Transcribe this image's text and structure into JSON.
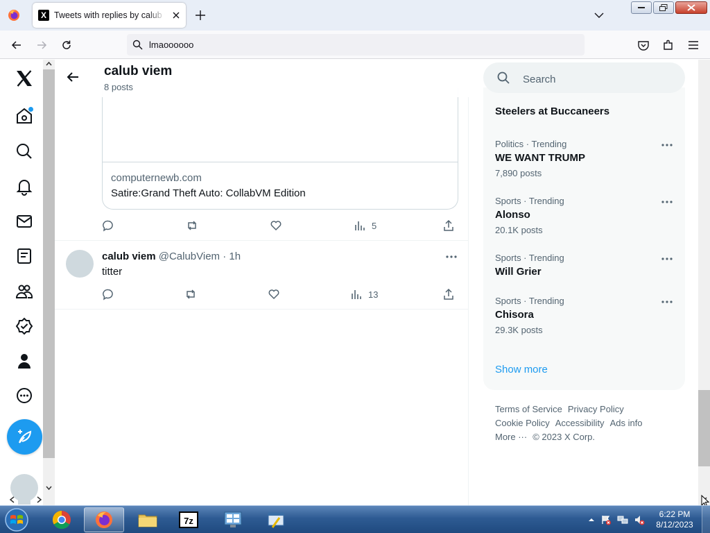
{
  "browser": {
    "tab_title": "Tweets with replies by calub viem",
    "tab_favicon": "X",
    "url": "lmaoooooo"
  },
  "page": {
    "header": {
      "name": "calub viem",
      "post_count": "8 posts"
    },
    "card": {
      "domain": "computernewb.com",
      "title": "Satire:Grand Theft Auto: CollabVM Edition"
    },
    "tweet1_actions": {
      "views": "5"
    },
    "tweet2": {
      "name": "calub viem",
      "handle": "@CalubViem",
      "separator": "·",
      "time": "1h",
      "text": "titter",
      "views": "13"
    }
  },
  "sidebar": {
    "search_placeholder": "Search",
    "trends": [
      {
        "context": "",
        "name": "Steelers at Buccaneers",
        "count": ""
      },
      {
        "context": "Politics · Trending",
        "name": "WE WANT TRUMP",
        "count": "7,890 posts"
      },
      {
        "context": "Sports · Trending",
        "name": "Alonso",
        "count": "20.1K posts"
      },
      {
        "context": "Sports · Trending",
        "name": "Will Grier",
        "count": ""
      },
      {
        "context": "Sports · Trending",
        "name": "Chisora",
        "count": "29.3K posts"
      }
    ],
    "show_more": "Show more",
    "footer": {
      "terms": "Terms of Service",
      "privacy": "Privacy Policy",
      "cookie": "Cookie Policy",
      "accessibility": "Accessibility",
      "ads": "Ads info",
      "more": "More ···",
      "copyright": "© 2023 X Corp."
    }
  },
  "taskbar": {
    "time": "6:22 PM",
    "date": "8/12/2023"
  },
  "colors": {
    "accent": "#1d9bf0",
    "text": "#0f1419",
    "muted": "#536471",
    "taskbar": "#2e5b93"
  },
  "icons": [
    "x-logo-icon",
    "home-icon",
    "explore-icon",
    "notifications-icon",
    "messages-icon",
    "lists-icon",
    "communities-icon",
    "verified-icon",
    "profile-icon",
    "more-icon",
    "compose-icon",
    "back-arrow-icon",
    "reply-icon",
    "retweet-icon",
    "like-icon",
    "views-icon",
    "share-icon",
    "search-icon"
  ]
}
